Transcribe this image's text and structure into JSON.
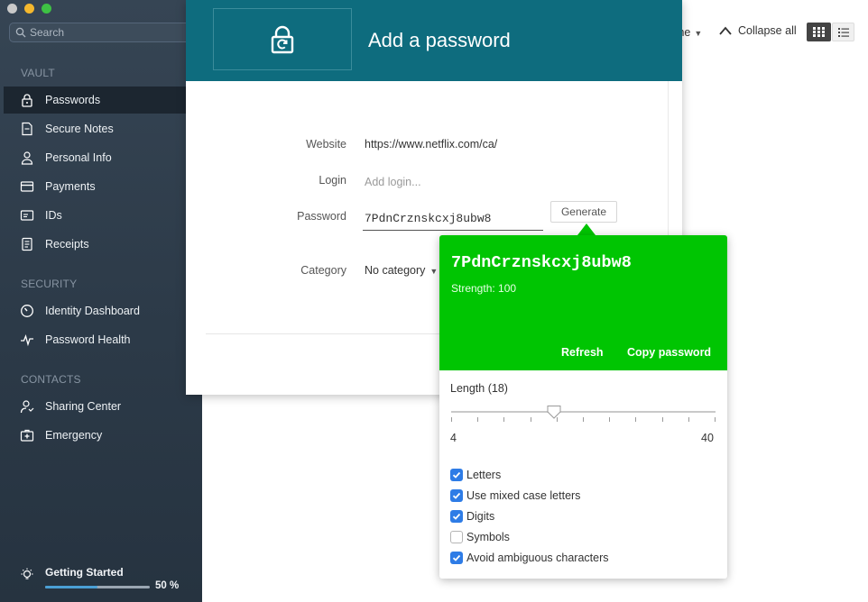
{
  "sidebar": {
    "search_placeholder": "Search",
    "sections": {
      "vault": "VAULT",
      "security": "SECURITY",
      "contacts": "CONTACTS"
    },
    "items": [
      {
        "label": "Passwords",
        "icon": "lock-icon",
        "active": true
      },
      {
        "label": "Secure Notes",
        "icon": "note-icon"
      },
      {
        "label": "Personal Info",
        "icon": "person-icon"
      },
      {
        "label": "Payments",
        "icon": "card-icon"
      },
      {
        "label": "IDs",
        "icon": "id-icon"
      },
      {
        "label": "Receipts",
        "icon": "receipt-icon"
      },
      {
        "label": "Identity Dashboard",
        "icon": "dashboard-icon"
      },
      {
        "label": "Password Health",
        "icon": "pulse-icon"
      },
      {
        "label": "Sharing Center",
        "icon": "share-icon"
      },
      {
        "label": "Emergency",
        "icon": "emergency-icon"
      }
    ],
    "getting_started": {
      "label": "Getting Started",
      "progress_pct": 50,
      "progress_text": "50 %"
    }
  },
  "toolbar": {
    "view_mode_fragment": "me",
    "collapse_all": "Collapse all"
  },
  "modal": {
    "title": "Add a password",
    "fields": {
      "website_label": "Website",
      "website_value": "https://www.netflix.com/ca/",
      "login_label": "Login",
      "login_placeholder": "Add login...",
      "password_label": "Password",
      "password_value": "7PdnCrznskcxj8ubw8",
      "generate_label": "Generate",
      "category_label": "Category",
      "category_value": "No category"
    }
  },
  "generator": {
    "password": "7PdnCrznskcxj8ubw8",
    "strength": "Strength: 100",
    "refresh": "Refresh",
    "copy": "Copy password",
    "length_label": "Length (18)",
    "length": 18,
    "min": "4",
    "max": "40",
    "options": [
      {
        "label": "Letters",
        "checked": true
      },
      {
        "label": "Use mixed case letters",
        "checked": true
      },
      {
        "label": "Digits",
        "checked": true
      },
      {
        "label": "Symbols",
        "checked": false
      },
      {
        "label": "Avoid ambiguous characters",
        "checked": true
      }
    ]
  },
  "colors": {
    "header_teal": "#0e6c7e",
    "generator_green": "#00c502",
    "checkbox_blue": "#2e7ce6"
  }
}
